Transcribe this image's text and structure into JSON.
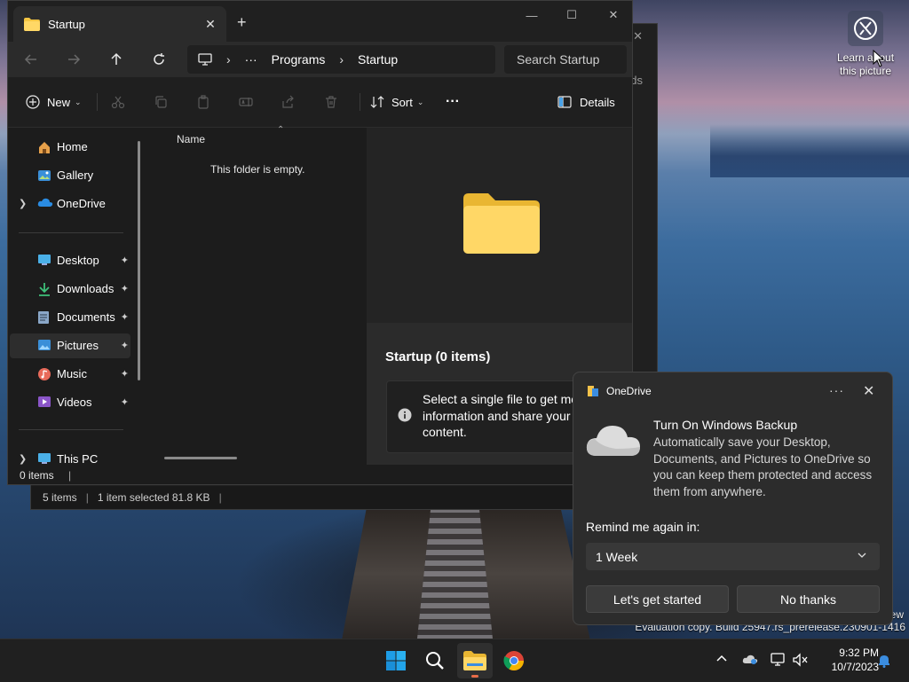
{
  "desktop": {
    "icon_label": "Learn about this picture",
    "watermark_line1": "ew",
    "watermark_line2": "Evaluation copy. Build 25947.rs_prerelease.230901-1416"
  },
  "back_window": {
    "status_items": "5 items",
    "status_selected": "1 item selected  81.8 KB",
    "partial_text": "ds"
  },
  "explorer": {
    "tab_title": "Startup",
    "address": {
      "ellipsis": "···",
      "segments": [
        "Programs",
        "Startup"
      ]
    },
    "search_placeholder": "Search Startup",
    "toolbar": {
      "new_label": "New",
      "sort_label": "Sort",
      "more_label": "···",
      "details_label": "Details"
    },
    "sidebar": {
      "items": [
        {
          "label": "Home"
        },
        {
          "label": "Gallery"
        },
        {
          "label": "OneDrive"
        },
        {
          "label": "Desktop"
        },
        {
          "label": "Downloads"
        },
        {
          "label": "Documents"
        },
        {
          "label": "Pictures"
        },
        {
          "label": "Music"
        },
        {
          "label": "Videos"
        },
        {
          "label": "This PC"
        }
      ],
      "pin_glyph": "📌"
    },
    "content": {
      "column_name": "Name",
      "empty_message": "This folder is empty."
    },
    "details_pane": {
      "title": "Startup (0 items)",
      "info_text": "Select a single file to get more information and share your cloud content."
    },
    "status": {
      "items": "0 items"
    }
  },
  "onedrive": {
    "app_name": "OneDrive",
    "more_label": "···",
    "close_label": "✕",
    "title": "Turn On Windows Backup",
    "description": "Automatically save your Desktop, Documents, and Pictures to OneDrive so you can keep them protected and access them from anywhere.",
    "remind_label": "Remind me again in:",
    "remind_value": "1 Week",
    "primary_button": "Let's get started",
    "secondary_button": "No thanks"
  },
  "taskbar": {
    "time": "9:32 PM",
    "date": "10/7/2023"
  }
}
